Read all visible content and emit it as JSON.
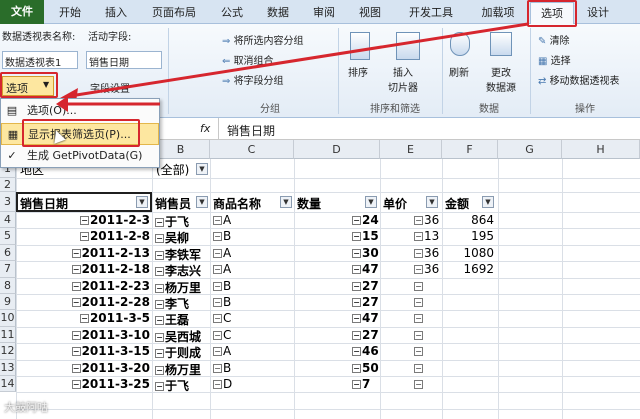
{
  "tabs": [
    "文件",
    "开始",
    "插入",
    "页面布局",
    "公式",
    "数据",
    "审阅",
    "视图",
    "开发工具",
    "加载项",
    "选项",
    "设计"
  ],
  "ribbon": {
    "pivot_name_label": "数据透视表名称:",
    "pivot_name_value": "数据透视表1",
    "active_field_label": "活动字段:",
    "active_field_value": "销售日期",
    "options_button": "选项",
    "field_settings": "字段设置",
    "group_selection": "将所选内容分组",
    "ungroup": "取消组合",
    "group_field": "将字段分组",
    "group_label": "分组",
    "sort": "排序",
    "insert_slicer": "插入\n切片器",
    "sort_filter_label": "排序和筛选",
    "refresh": "刷新",
    "change_source": "更改\n数据源",
    "data_label": "数据",
    "clear": "清除",
    "select": "选择",
    "move_pivot": "移动数据透视表",
    "actions_label": "操作",
    "active_field_group": "段"
  },
  "menu": {
    "items": [
      "选项(O)...",
      "显示报表筛选页(P)...",
      "生成 GetPivotData(G)"
    ]
  },
  "formula_bar": {
    "fx": "fx",
    "value": "销售日期"
  },
  "columns": [
    "A",
    "B",
    "C",
    "D",
    "E",
    "F",
    "G",
    "H"
  ],
  "filter_row": {
    "label": "地区",
    "value": "(全部)"
  },
  "headers": {
    "date": "销售日期",
    "seller": "销售员",
    "product": "商品名称",
    "qty": "数量",
    "price": "单价",
    "amount": "金额"
  },
  "rows": [
    {
      "n": "4",
      "date": "2011-2-3",
      "seller": "于飞",
      "product": "A",
      "qty": "24",
      "price": "36",
      "amount": "864"
    },
    {
      "n": "5",
      "date": "2011-2-8",
      "seller": "吴柳",
      "product": "B",
      "qty": "15",
      "price": "13",
      "amount": "195"
    },
    {
      "n": "6",
      "date": "2011-2-13",
      "seller": "李铁军",
      "product": "A",
      "qty": "30",
      "price": "36",
      "amount": "1080"
    },
    {
      "n": "7",
      "date": "2011-2-18",
      "seller": "李志兴",
      "product": "A",
      "qty": "47",
      "price": "36",
      "amount": "1692"
    },
    {
      "n": "8",
      "date": "2011-2-23",
      "seller": "杨万里",
      "product": "B",
      "qty": "27",
      "price": "",
      "amount": ""
    },
    {
      "n": "9",
      "date": "2011-2-28",
      "seller": "李飞",
      "product": "B",
      "qty": "27",
      "price": "",
      "amount": ""
    },
    {
      "n": "10",
      "date": "2011-3-5",
      "seller": "王磊",
      "product": "C",
      "qty": "47",
      "price": "",
      "amount": ""
    },
    {
      "n": "11",
      "date": "2011-3-10",
      "seller": "吴西城",
      "product": "C",
      "qty": "27",
      "price": "",
      "amount": ""
    },
    {
      "n": "12",
      "date": "2011-3-15",
      "seller": "于则成",
      "product": "A",
      "qty": "46",
      "price": "",
      "amount": ""
    },
    {
      "n": "13",
      "date": "2011-3-20",
      "seller": "杨万里",
      "product": "B",
      "qty": "50",
      "price": "",
      "amount": ""
    },
    {
      "n": "14",
      "date": "2011-3-25",
      "seller": "于飞",
      "product": "D",
      "qty": "7",
      "price": "",
      "amount": ""
    }
  ],
  "row_numbers": {
    "r1": "1",
    "r2": "2",
    "r3": "3"
  },
  "watermark": "大鼓阿咕",
  "colors": {
    "highlight": "#d6262e",
    "file_tab": "#2a6d2a",
    "hover": "#fde7a0"
  }
}
